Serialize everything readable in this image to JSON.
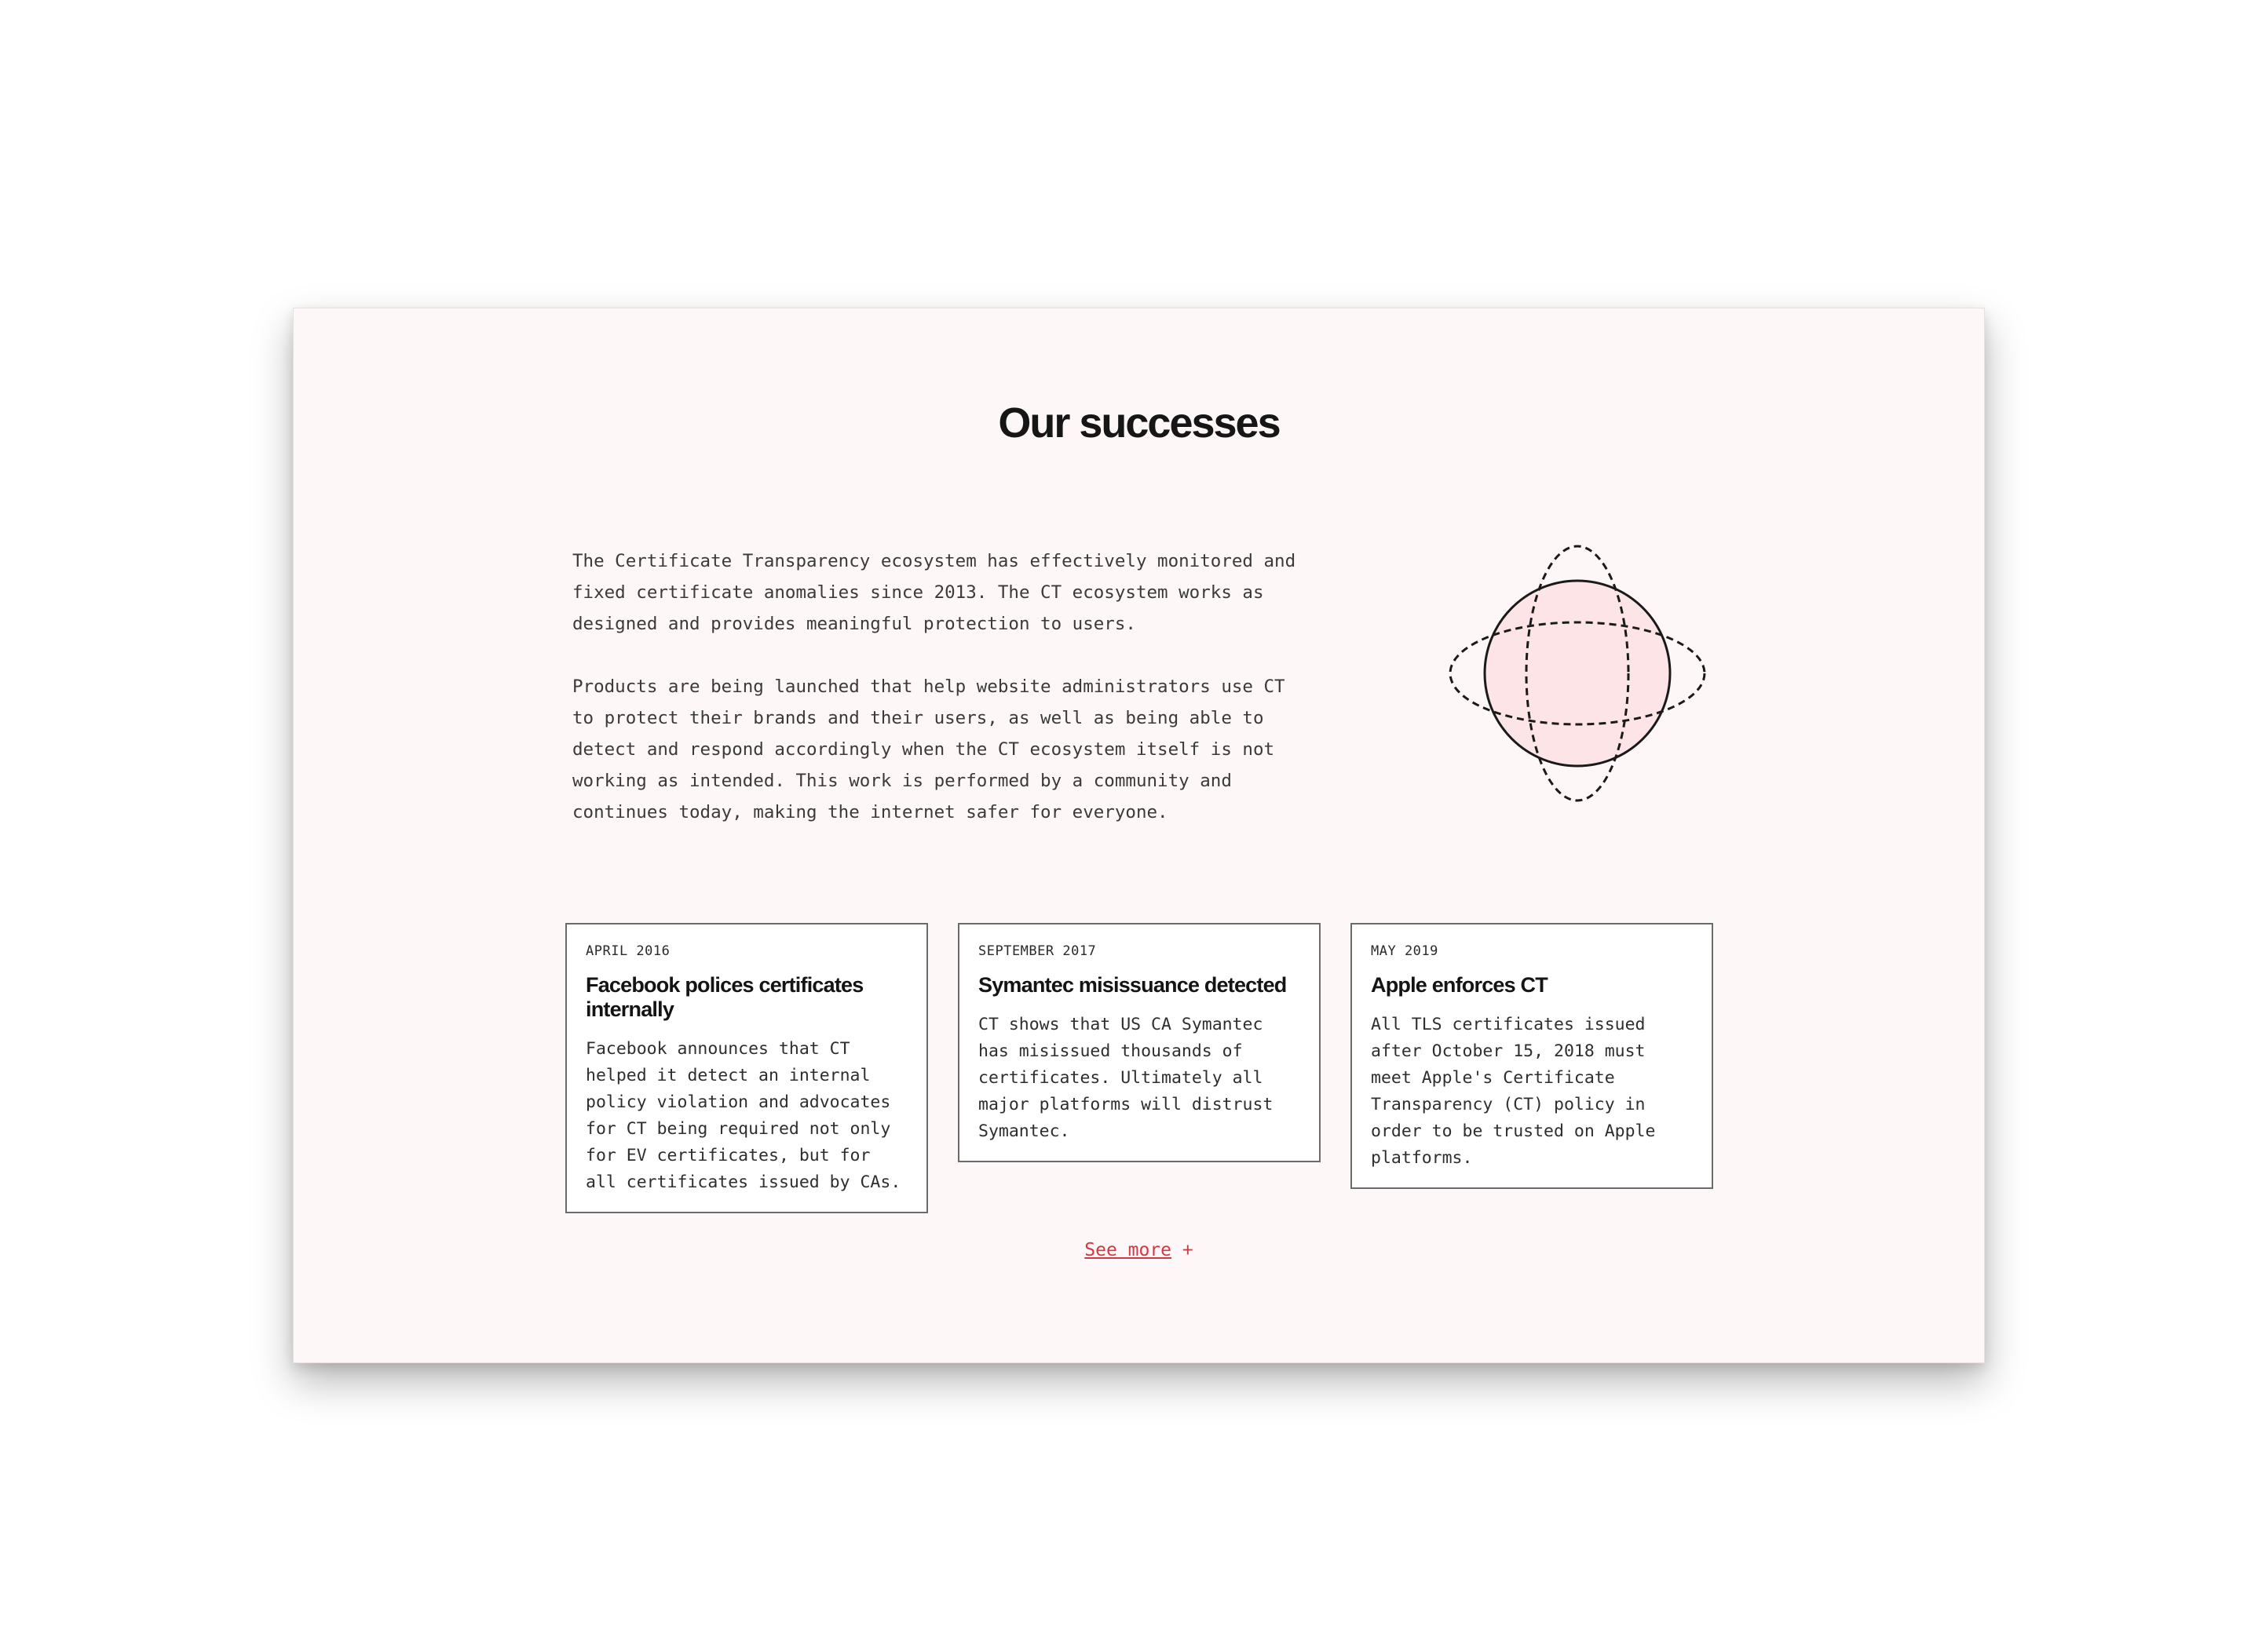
{
  "section": {
    "title": "Our successes",
    "paragraphs": [
      "The Certificate Transparency ecosystem has effectively monitored and fixed certificate anomalies since 2013. The CT ecosystem works as designed and provides meaningful protection to users.",
      "Products are being launched that help website administrators use CT to protect their brands and their users, as well as being able to detect and respond accordingly when the CT ecosystem itself is not working as intended. This work is performed by a community and continues today, making the internet safer for everyone."
    ],
    "illustration_icon": "globe-orbits-icon"
  },
  "cards": [
    {
      "date": "APRIL 2016",
      "title": "Facebook polices certificates internally",
      "body": "Facebook announces that CT helped it detect an internal policy violation and advocates for CT being required not only for EV certificates, but for all certificates issued by CAs."
    },
    {
      "date": "SEPTEMBER 2017",
      "title": "Symantec misissuance detected",
      "body": "CT shows that US CA Symantec has misissued thousands of certificates. Ultimately all major platforms will distrust Symantec."
    },
    {
      "date": "MAY 2019",
      "title": "Apple enforces CT",
      "body": "All TLS certificates issued after October 15, 2018 must meet Apple's Certificate Transparency (CT) policy in order to be trusted on Apple platforms."
    }
  ],
  "see_more": {
    "label": "See more",
    "suffix": "+"
  },
  "colors": {
    "panel_background": "#fdf7f7",
    "accent": "#d13a44",
    "globe_fill": "#fde4e6",
    "text": "#161616"
  }
}
